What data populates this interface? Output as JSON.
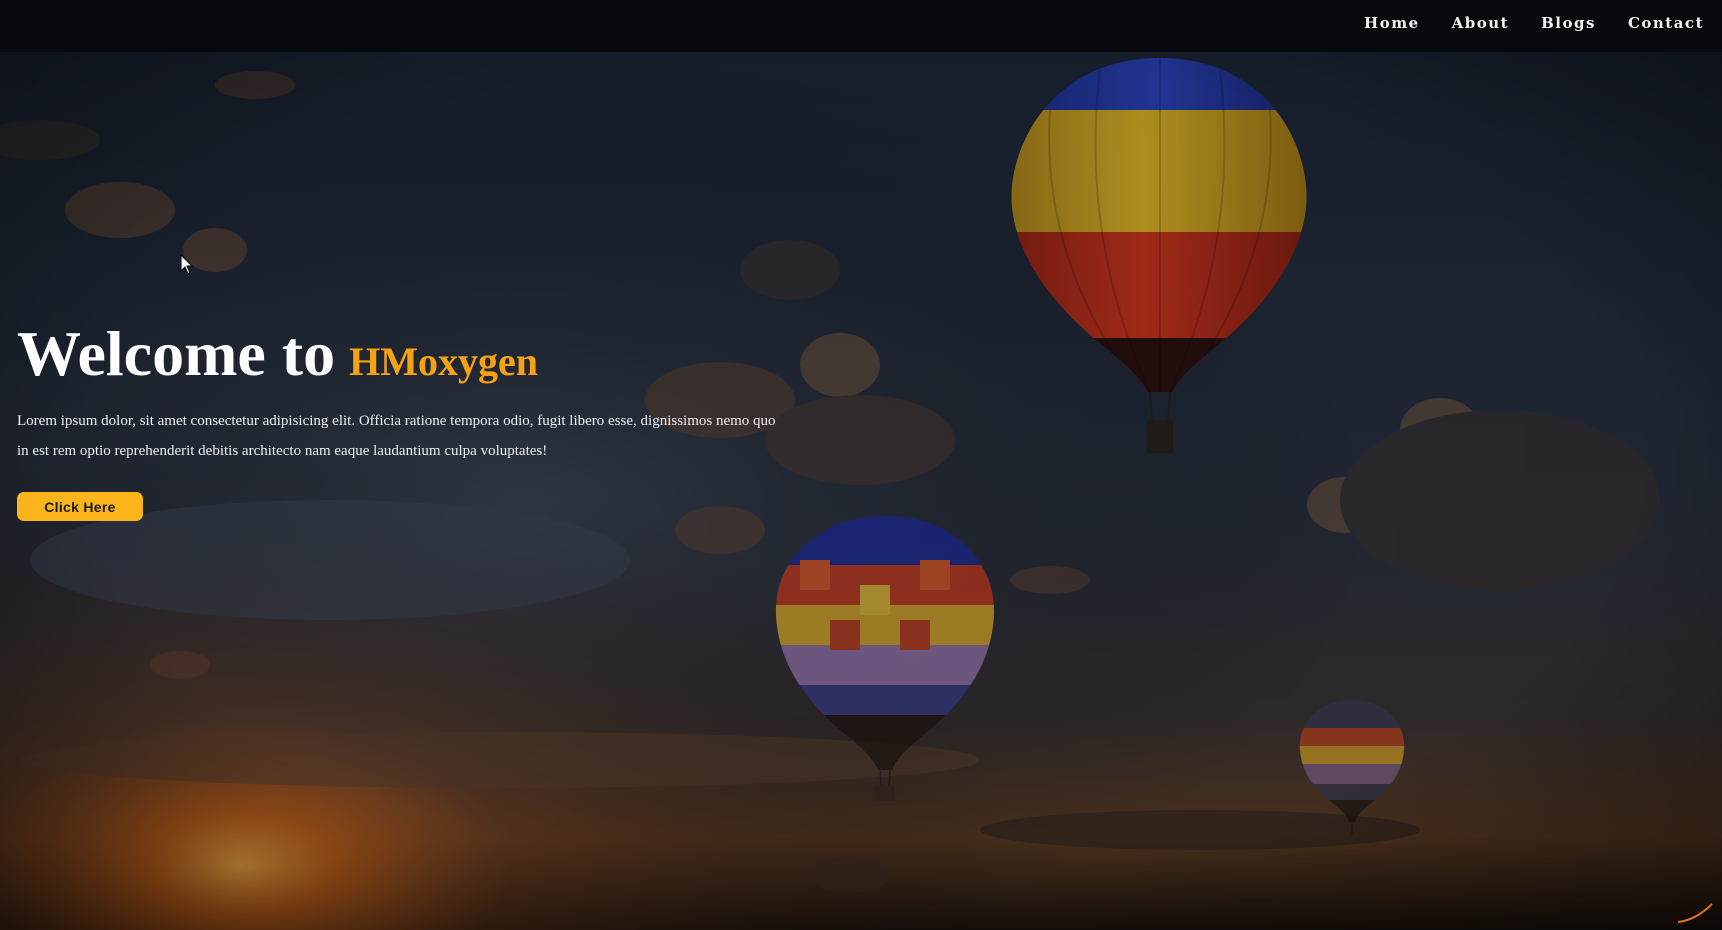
{
  "nav": {
    "items": [
      {
        "label": "Home"
      },
      {
        "label": "About"
      },
      {
        "label": "Blogs"
      },
      {
        "label": "Contact"
      }
    ]
  },
  "hero": {
    "title_prefix": "Welcome to",
    "brand": "HMoxygen",
    "description": "Lorem ipsum dolor, sit amet consectetur adipisicing elit. Officia ratione tempora odio, fugit libero esse, dignissimos nemo quo in est rem optio reprehenderit debitis architecto nam eaque laudantium culpa voluptates!",
    "button_label": "Click Here"
  },
  "colors": {
    "accent": "#f5a314",
    "button": "#fbb51b",
    "navbar": "#07090e"
  }
}
